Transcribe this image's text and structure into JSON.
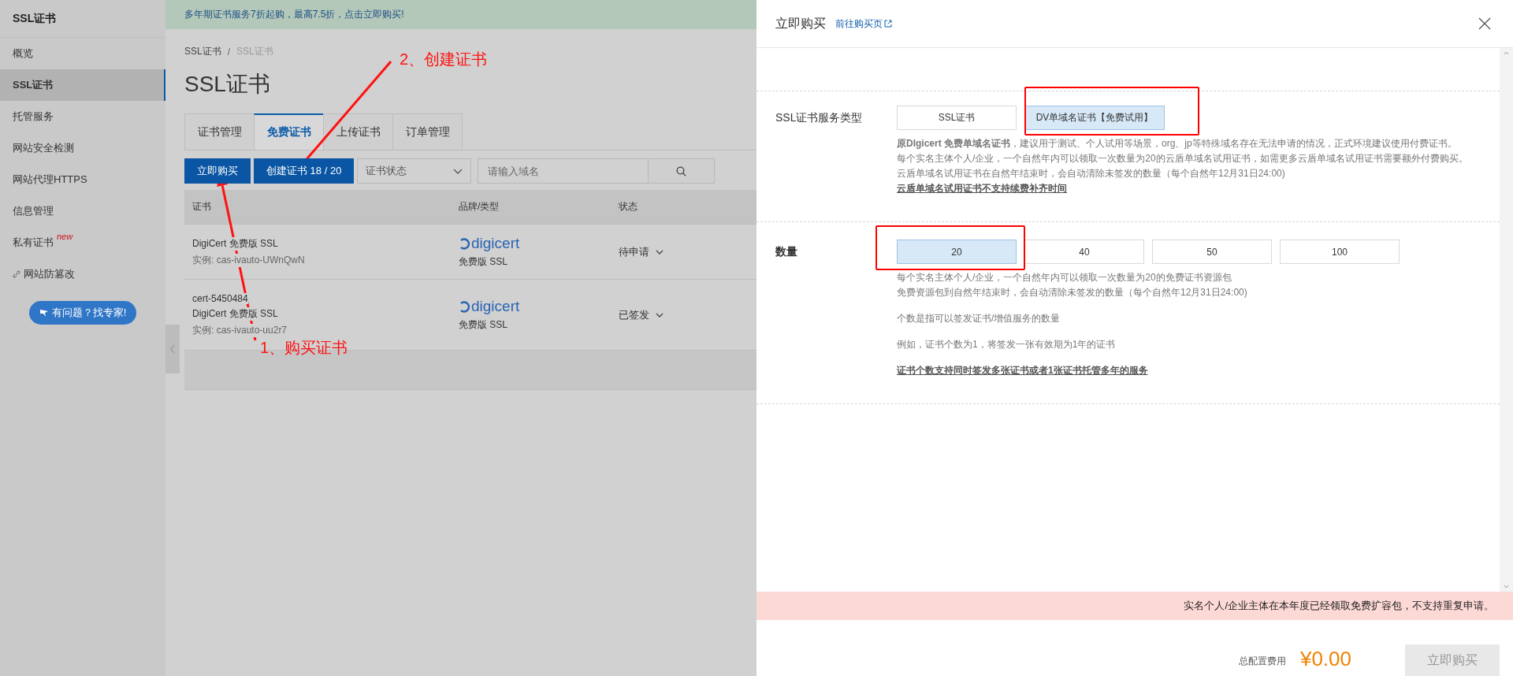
{
  "sidebar": {
    "title": "SSL证书",
    "items": [
      {
        "label": "概览",
        "selected": false
      },
      {
        "label": "SSL证书",
        "selected": true
      },
      {
        "label": "托管服务",
        "selected": false
      },
      {
        "label": "网站安全检测",
        "selected": false
      },
      {
        "label": "网站代理HTTPS",
        "selected": false
      },
      {
        "label": "信息管理",
        "selected": false
      },
      {
        "label": "私有证书",
        "selected": false,
        "badge": "new"
      },
      {
        "label": "网站防篡改",
        "selected": false,
        "kind": "link"
      }
    ],
    "help_button": "有问题？找专家!"
  },
  "banner": "多年期证书服务7折起购，最高7.5折，点击立即购买!",
  "breadcrumb": [
    "SSL证书",
    "SSL证书"
  ],
  "breadcrumb_separator": "/",
  "page_title": "SSL证书",
  "tabs": [
    {
      "label": "证书管理",
      "selected": false
    },
    {
      "label": "免费证书",
      "selected": true
    },
    {
      "label": "上传证书",
      "selected": false
    },
    {
      "label": "订单管理",
      "selected": false
    }
  ],
  "toolbar": {
    "buy_button": "立即购买",
    "create_button": "创建证书 18 / 20",
    "status_select": "证书状态",
    "search": {
      "placeholder": "请输入域名"
    }
  },
  "table": {
    "columns": [
      "证书",
      "品牌/类型",
      "状态"
    ],
    "rows": [
      {
        "lines": [
          "DigiCert 免费版 SSL"
        ],
        "instance": "实例: cas-ivauto-UWnQwN",
        "brand": "digicert",
        "type": "免费版 SSL",
        "status": "待申请"
      },
      {
        "lines": [
          "cert-5450484",
          "DigiCert 免费版 SSL"
        ],
        "instance": "实例: cas-ivauto-uu2r7",
        "brand": "digicert",
        "type": "免费版 SSL",
        "status": "已签发"
      }
    ]
  },
  "drawer": {
    "title": "立即购买",
    "link": "前往购买页",
    "rows": [
      {
        "label": "SSL证书服务类型",
        "options": [
          {
            "label": "SSL证书",
            "selected": false
          },
          {
            "label": "DV单域名证书【免费试用】",
            "selected": true
          }
        ],
        "notes": [
          {
            "lines": [
              {
                "text": "**原DIgicert 免费单域名证书**，建议用于测试、个人试用等场景，org、jp等特殊域名存在无法申请的情况，正式环境建议使用付费证书。",
                "kind": "text"
              },
              {
                "text": "每个实名主体个人/企业，一个自然年内可以领取一次数量为20的云盾单域名试用证书，如需更多云盾单域名试用证书需要额外付费购买。",
                "kind": "text"
              },
              {
                "text": "云盾单域名试用证书在自然年结束时，会自动清除未签发的数量（每个自然年12月31日24:00)",
                "kind": "text"
              },
              {
                "text": "云盾单域名试用证书不支持续费补齐时间",
                "kind": "strong"
              }
            ]
          }
        ]
      },
      {
        "label": "数量",
        "options": [
          {
            "label": "20",
            "selected": true
          },
          {
            "label": "40",
            "selected": false
          },
          {
            "label": "50",
            "selected": false
          },
          {
            "label": "100",
            "selected": false
          }
        ],
        "notes": [
          {
            "lines": [
              {
                "text": "每个实名主体个人/企业，一个自然年内可以领取一次数量为20的免费证书资源包",
                "kind": "text"
              },
              {
                "text": "免费资源包到自然年结束时，会自动清除未签发的数量（每个自然年12月31日24:00)",
                "kind": "text"
              }
            ]
          },
          {
            "lines": [
              {
                "text": "个数是指可以签发证书/增值服务的数量",
                "kind": "text"
              }
            ]
          },
          {
            "lines": [
              {
                "text": "例如，证书个数为1，将签发一张有效期为1年的证书",
                "kind": "text"
              }
            ]
          },
          {
            "lines": [
              {
                "text": "证书个数支持同时签发多张证书或者1张证书托管多年的服务",
                "kind": "strong"
              }
            ]
          }
        ]
      }
    ],
    "warning": "实名个人/企业主体在本年度已经领取免费扩容包，不支持重复申请。",
    "total_label": "总配置费用",
    "total": "¥0.00",
    "submit_button": {
      "label": "立即购买",
      "disabled": true
    }
  },
  "annotations": [
    {
      "label": "1、购买证书"
    },
    {
      "label": "2、创建证书"
    }
  ]
}
